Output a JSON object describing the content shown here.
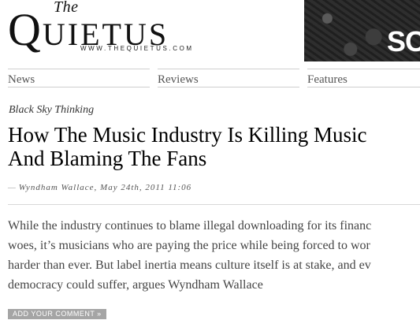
{
  "masthead": {
    "logo_the": "The",
    "logo_q": "Q",
    "logo_rest": "UIETUS",
    "url": "WWW.THEQUIETUS.COM"
  },
  "banner": {
    "text": "SC"
  },
  "nav": {
    "items": [
      {
        "label": "News"
      },
      {
        "label": "Reviews"
      },
      {
        "label": "Features"
      }
    ]
  },
  "article": {
    "section": "Black Sky Thinking",
    "headline_line1": "How The Music Industry Is Killing Music",
    "headline_line2": "And Blaming The Fans",
    "byline_dash": "—",
    "author": "Wyndham Wallace",
    "date": ", May 24th, 2011 11:06",
    "standfirst_lines": [
      "While the industry continues to blame illegal downloading for its financ",
      "woes, it’s musicians who are paying the price while being forced to wor",
      "harder than ever. But label inertia means culture itself is at stake, and ev",
      "democracy could suffer, argues Wyndham Wallace"
    ],
    "comment_button": "ADD YOUR COMMENT »"
  }
}
